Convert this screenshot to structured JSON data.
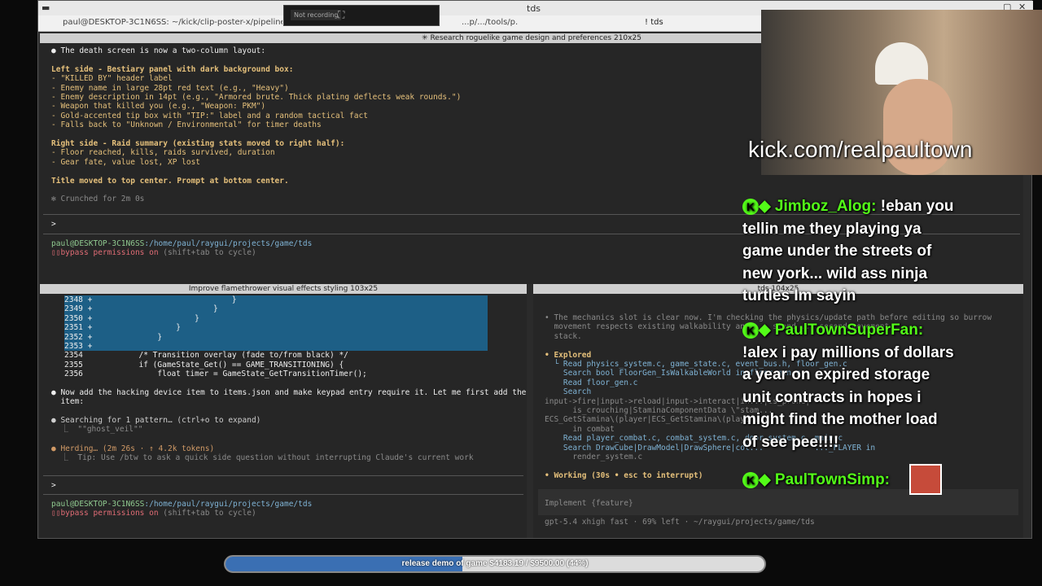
{
  "window": {
    "title": "tds",
    "tabs": [
      "paul@DESKTOP-3C1N6SS: ~/kick/clip-poster-x/pipeline_ui",
      "...p/.../tools/p...",
      "! tds"
    ]
  },
  "recorder": {
    "status": "Not recording"
  },
  "pane_top": {
    "title": "✳ Research roguelike game design and preferences 210x25",
    "lines": [
      "● The death screen is now a two-column layout:",
      "",
      "Left side - Bestiary panel with dark background box:",
      "- \"KILLED BY\" header label",
      "- Enemy name in large 28pt red text (e.g., \"Heavy\")",
      "- Enemy description in 14pt (e.g., \"Armored brute. Thick plating deflects weak rounds.\")",
      "- Weapon that killed you (e.g., \"Weapon: PKM\")",
      "- Gold-accented tip box with \"TIP:\" label and a random tactical fact",
      "- Falls back to \"Unknown / Environmental\" for timer deaths",
      "",
      "Right side - Raid summary (existing stats moved to right half):",
      "- Floor reached, kills, raids survived, duration",
      "- Gear fate, value lost, XP lost",
      "",
      "Title moved to top center. Prompt at bottom center.",
      "",
      "✻ Crunched for 2m 0s"
    ],
    "prompt": ">",
    "user": "paul@DESKTOP-3C1N6SS",
    "path": ":/home/paul/raygui/projects/game/tds",
    "perm": "bypass permissions on",
    "permhint": " (shift+tab to cycle)"
  },
  "pane_bl": {
    "title": "Improve flamethrower visual effects styling 103x25",
    "code": [
      [
        "2348 +",
        "                            }"
      ],
      [
        "2349 +",
        "                        }"
      ],
      [
        "2350 +",
        "                    }"
      ],
      [
        "2351 +",
        "                }"
      ],
      [
        "2352 +",
        "            }"
      ],
      [
        "2353 +",
        ""
      ],
      [
        "2354  ",
        "        /* Transition overlay (fade to/from black) */"
      ],
      [
        "2355  ",
        "        if (GameState_Get() == GAME_TRANSITIONING) {"
      ],
      [
        "2356  ",
        "            float timer = GameState_GetTransitionTimer();"
      ]
    ],
    "msg1": "● Now add the hacking device item to items.json and make keypad entry require it. Let me first add the",
    "msg2": "  item:",
    "search": "● Searching for 1 pattern… (ctrl+o to expand)",
    "searchq": "  ⎿  \"\"ghost_veil\"\"",
    "herding": "● Herding… (2m 26s · ↑ 4.2k tokens)",
    "tip": "  ⎿  Tip: Use /btw to ask a quick side question without interrupting Claude's current work",
    "prompt": ">",
    "user": "paul@DESKTOP-3C1N6SS",
    "path": ":/home/paul/raygui/projects/game/tds",
    "perm": "bypass permissions on",
    "permhint": " (shift+tab to cycle)"
  },
  "pane_br": {
    "title": "tds 104x25",
    "lines": [
      "• The mechanics slot is clear now. I'm checking the physics/update path before editing so burrow",
      "  movement respects existing walkability and ... stand ... second movement",
      "  stack.",
      "",
      "• Explored",
      "  └ Read physics_system.c, game_state.c, event_bus.h, floor_gen.c",
      "    Search bool FloorGen_IsWalkableWorld in floor_gen.c",
      "    Read floor_gen.c",
      "    Search",
      "input->fire|input->reload|input->interact|in...|is_prone|",
      "      is_crouching|StaminaComponentData \\\"stam...",
      "ECS_GetStamina\\(player|ECS_GetStamina\\(player...",
      "      in combat",
      "    Read player_combat.c, combat_system.c, door_system.c, main.c",
      "    Search DrawCube|DrawModel|DrawSphere|col...           ..._PLAYER in",
      "      render_system.c",
      "",
      "• Working (30s • esc to interrupt)"
    ],
    "input": "Implement {feature}",
    "status": "gpt-5.4 xhigh fast · 69% left · ~/raygui/projects/game/tds"
  },
  "overlay": {
    "url": "kick.com/realpaultown",
    "chat": [
      {
        "user": "Jimboz_Alog:",
        "text": "!eban you tellin me they playing ya game under the streets of new york... wild ass ninja turtles Im sayin"
      },
      {
        "user": "PaulTownSuperFan:",
        "text": "!alex i pay millions of dollars a year on expired storage unit contracts in hopes i might find the mother load of see pee!!!!"
      },
      {
        "user": "PaulTownSimp:",
        "text": ""
      }
    ],
    "goal": {
      "label": "release demo of game $4183.19 / $9500.00 (44%)",
      "progress": 0.44
    }
  }
}
